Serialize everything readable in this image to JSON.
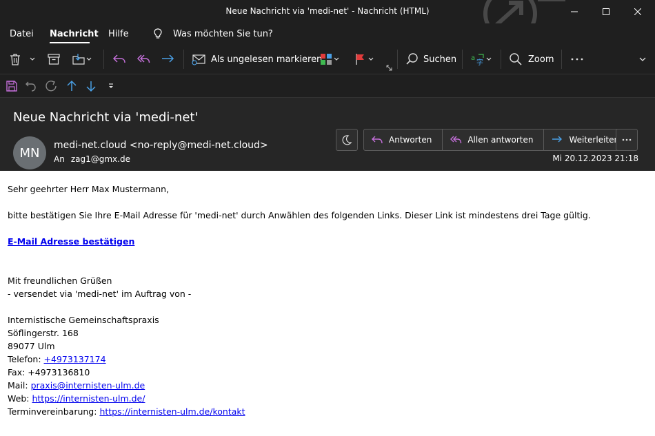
{
  "window": {
    "title": "Neue Nachricht via 'medi-net'  -  Nachricht (HTML)"
  },
  "menu": {
    "items": [
      "Datei",
      "Nachricht",
      "Hilfe"
    ],
    "tell_me": "Was möchten Sie tun?"
  },
  "ribbon": {
    "mark_unread": "Als ungelesen markieren",
    "search": "Suchen",
    "zoom": "Zoom"
  },
  "message": {
    "subject": "Neue Nachricht via 'medi-net'",
    "avatar_initials": "MN",
    "sender": "medi-net.cloud <no-reply@medi-net.cloud>",
    "to_label": "An",
    "to_address": "zag1@gmx.de",
    "date": "Mi 20.12.2023 21:18",
    "actions": {
      "reply": "Antworten",
      "reply_all": "Allen antworten",
      "forward": "Weiterleiten"
    }
  },
  "body": {
    "greeting": "Sehr geehrter Herr Max Mustermann,",
    "intro": "bitte bestätigen Sie Ihre E-Mail Adresse für 'medi-net' durch Anwählen des folgenden Links. Dieser Link ist mindestens drei Tage gültig.",
    "confirm_link": "E-Mail Adresse bestätigen",
    "closing": "Mit freundlichen Grüßen",
    "sent_via": "- versendet via 'medi-net' im Auftrag von -",
    "org_name": "Internistische Gemeinschaftspraxis",
    "street": "Söflingerstr. 168",
    "city": "89077 Ulm",
    "phone_label": "Telefon: ",
    "phone": "+4973137174",
    "fax": "Fax: +4973136810",
    "mail_label": "Mail: ",
    "mail": "praxis@internisten-ulm.de",
    "web_label": "Web: ",
    "web": "https://internisten-ulm.de/",
    "appointment_label": "Terminvereinbarung: ",
    "appointment": "https://internisten-ulm.de/kontakt"
  },
  "colors": {
    "accent_purple": "#c36fd9",
    "accent_blue": "#4aa0e6",
    "flag_red": "#e23b3b",
    "link_blue": "#0000ee"
  }
}
